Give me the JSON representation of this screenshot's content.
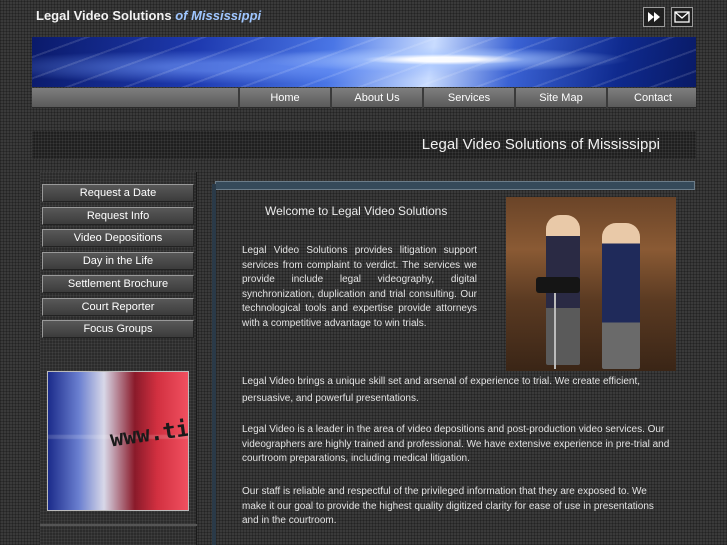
{
  "header": {
    "title_main": "Legal Video Solutions",
    "title_accent": "of Mississippi",
    "icons": [
      "fast-forward-icon",
      "envelope-icon"
    ]
  },
  "nav": {
    "items": [
      "Home",
      "About Us",
      "Services",
      "Site Map",
      "Contact"
    ]
  },
  "section_title": "Legal Video Solutions of  Mississippi",
  "sidebar": {
    "items": [
      "Request a Date",
      "Request Info",
      "Video Depositions",
      "Day in the Life",
      "Settlement Brochure",
      "Court Reporter",
      "Focus Groups"
    ],
    "image_text": "www.ti"
  },
  "main": {
    "welcome": "Welcome to Legal Video Solutions",
    "paragraphs": [
      "Legal Video Solutions provides litigation support services from complaint to verdict. The services we provide include legal videography, digital synchronization, duplication and trial consulting. Our technological tools and expertise provide attorneys with a competitive advantage to win trials.",
      "Legal Video brings a unique skill set and arsenal of experience to trial.  We create efficient, persuasive, and powerful presentations.",
      "Legal Video is a leader in the area of video depositions and post-production video services.  Our videographers are highly trained and professional.   We have extensive experience in pre-trial and courtroom preparations, including medical litigation.",
      "Our staff is reliable and respectful of the privileged information that they are exposed to.  We make it our goal to provide the highest quality digitized clarity for ease of use in presentations and in the courtroom."
    ]
  },
  "colors": {
    "accent": "#9fc6ff",
    "banner_blue": "#1e3ab0"
  }
}
